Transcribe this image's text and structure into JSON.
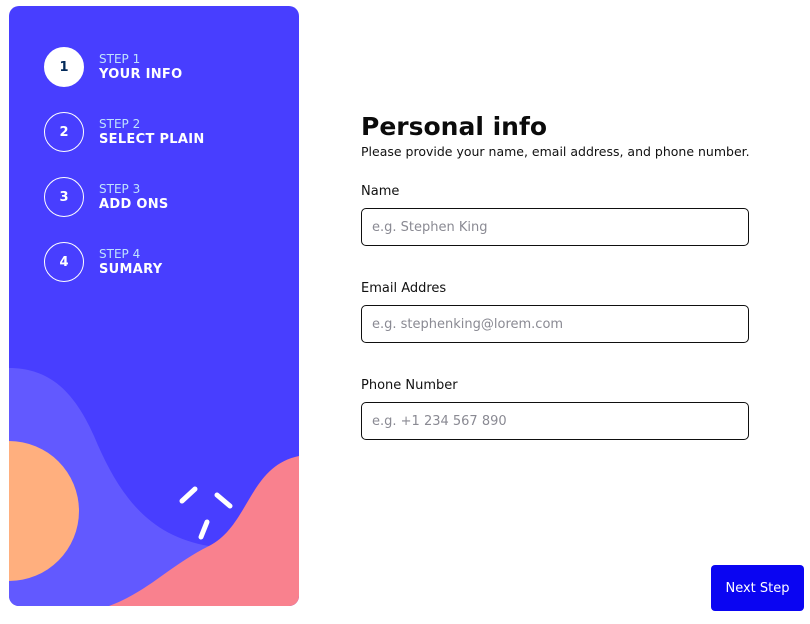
{
  "sidebar": {
    "steps": [
      {
        "number": "1",
        "label": "STEP 1",
        "title": "YOUR INFO",
        "active": true
      },
      {
        "number": "2",
        "label": "STEP 2",
        "title": "SELECT PLAIN",
        "active": false
      },
      {
        "number": "3",
        "label": "STEP 3",
        "title": "ADD ONS",
        "active": false
      },
      {
        "number": "4",
        "label": "STEP 4",
        "title": "SUMARY",
        "active": false
      }
    ]
  },
  "main": {
    "title": "Personal info",
    "subtitle": "Please provide your name, email address, and phone number.",
    "fields": {
      "name": {
        "label": "Name",
        "placeholder": "e.g. Stephen King",
        "value": ""
      },
      "email": {
        "label": "Email Addres",
        "placeholder": "e.g. stephenking@lorem.com",
        "value": ""
      },
      "phone": {
        "label": "Phone Number",
        "placeholder": "e.g. +1 234 567 890",
        "value": ""
      }
    }
  },
  "footer": {
    "next_label": "Next Step"
  },
  "colors": {
    "sidebar_bg": "#483eff",
    "wave": "#6259ff",
    "orange_blob": "#ffaf7e",
    "pink_blob": "#f9818e",
    "button": "#0a05f2"
  }
}
